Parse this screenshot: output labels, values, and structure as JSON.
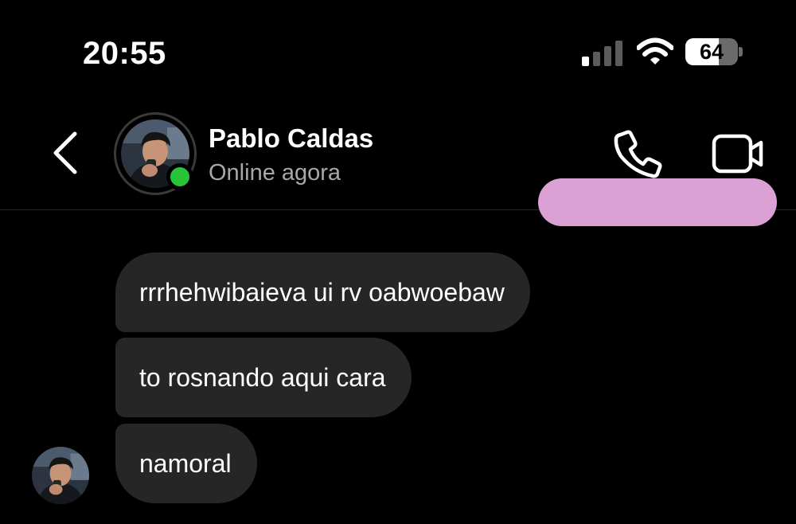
{
  "status_bar": {
    "time": "20:55",
    "battery_level": "64",
    "signal_bars_active": 1,
    "signal_bars_total": 4
  },
  "header": {
    "contact_name": "Pablo Caldas",
    "contact_status": "Online agora",
    "online_indicator_color": "#29c43a",
    "icons": [
      "back-chevron-icon",
      "phone-icon",
      "video-camera-icon"
    ]
  },
  "messages": [
    {
      "direction": "received",
      "text": "rrrhehwibaieva ui rv oabwoebaw"
    },
    {
      "direction": "received",
      "text": "to rosnando aqui cara"
    },
    {
      "direction": "received",
      "text": "namoral"
    }
  ],
  "colors": {
    "background": "#000000",
    "received_bubble": "#262626",
    "sent_bubble": "#dba0d4",
    "secondary_text": "#a8a8a8"
  }
}
